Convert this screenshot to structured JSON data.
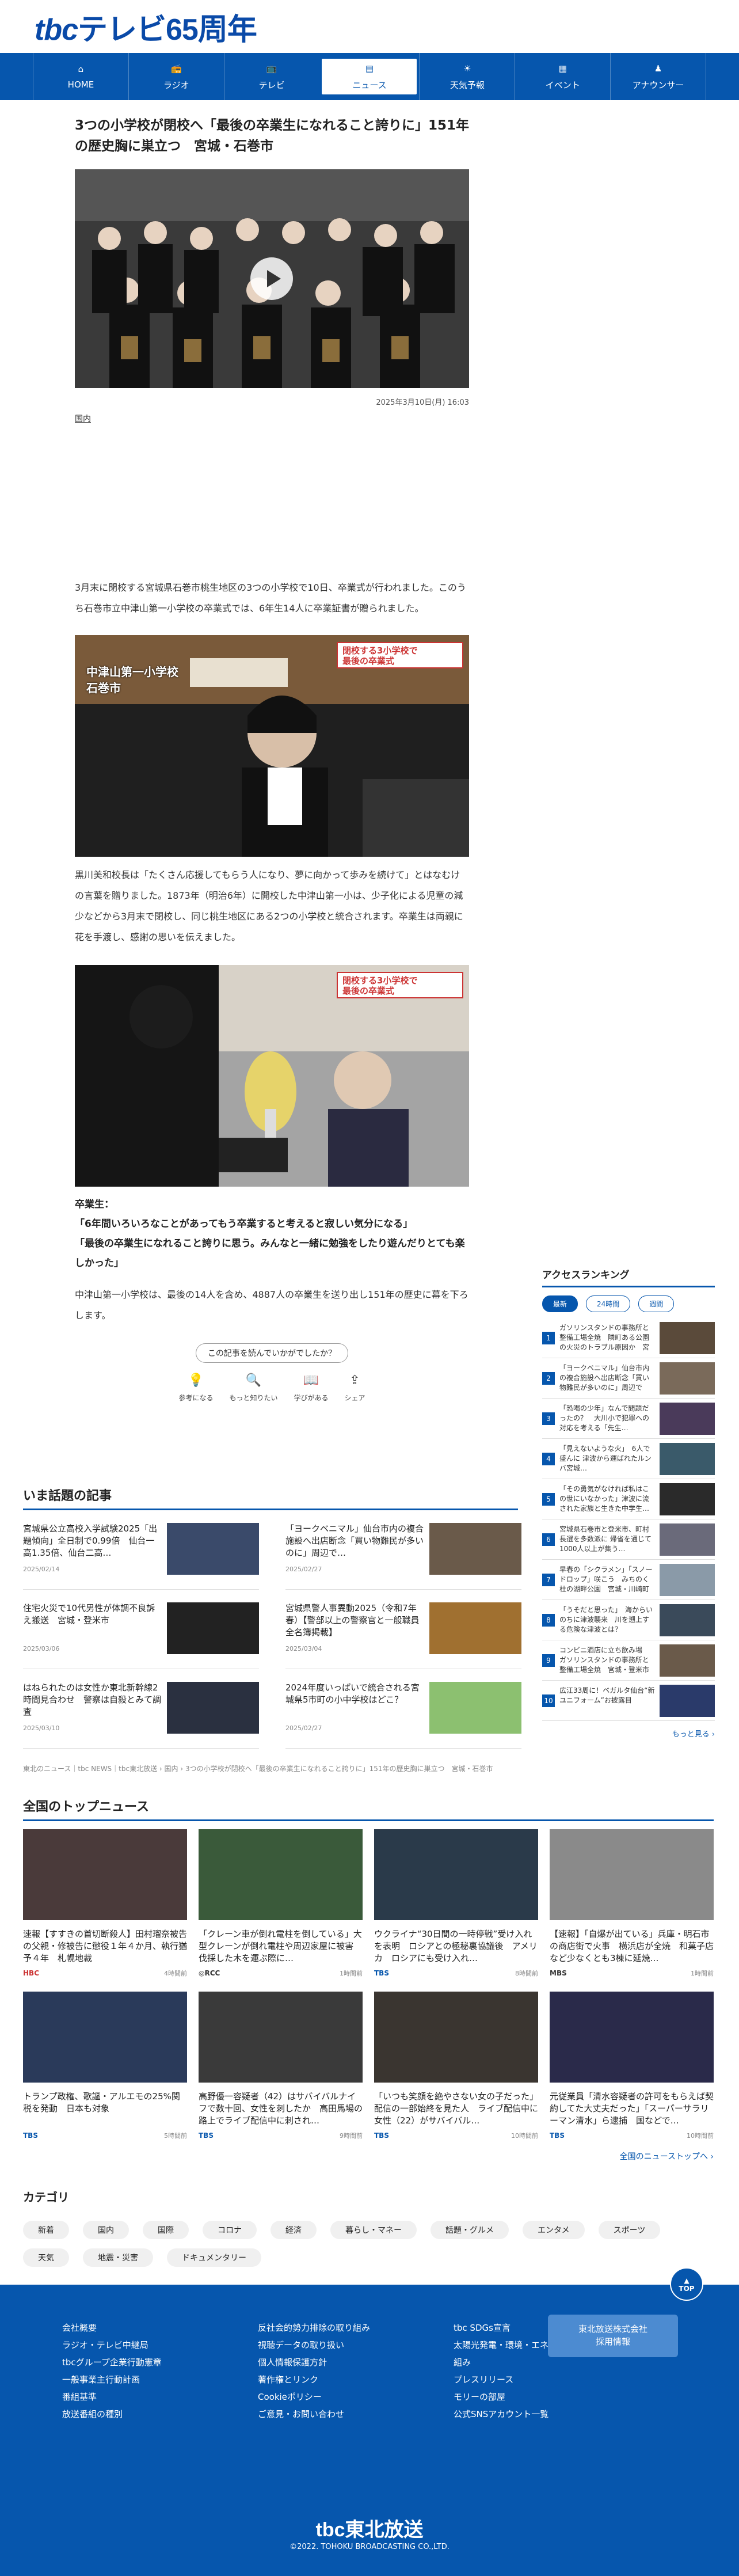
{
  "logo": {
    "tbc": "tbc",
    "text": "テレビ65周年"
  },
  "nav": [
    {
      "label": "HOME",
      "icon": "home-icon",
      "glyph": "⌂"
    },
    {
      "label": "ラジオ",
      "icon": "radio-icon",
      "glyph": "📻"
    },
    {
      "label": "テレビ",
      "icon": "tv-icon",
      "glyph": "📺"
    },
    {
      "label": "ニュース",
      "icon": "news-icon",
      "glyph": "▤"
    },
    {
      "label": "天気予報",
      "icon": "weather-icon",
      "glyph": "☀"
    },
    {
      "label": "イベント",
      "icon": "event-icon",
      "glyph": "▦"
    },
    {
      "label": "アナウンサー",
      "icon": "announcer-icon",
      "glyph": "♟"
    }
  ],
  "article": {
    "title": "3つの小学校が閉校へ「最後の卒業生になれること誇りに」151年の歴史胸に巣立つ　宮城・石巻市",
    "date": "2025年3月10日(月) 16:03",
    "tag": "国内",
    "p1": "3月末に閉校する宮城県石巻市桃生地区の3つの小学校で10日、卒業式が行われました。このうち石巻市立中津山第一小学校の卒業式では、6年生14人に卒業証書が贈られました。",
    "photo1_location": "中津山第一小学校\n石巻市",
    "photo_caption_top": "閉校する3小学校で",
    "photo_caption_bottom": "最後の卒業式",
    "p2": "黒川美和校長は「たくさん応援してもらう人になり、夢に向かって歩みを続けて」とはなむけの言葉を贈りました。1873年（明治6年）に開校した中津山第一小は、少子化による児童の減少などから3月末で閉校し、同じ桃生地区にある2つの小学校と統合されます。卒業生は両親に花を手渡し、感謝の思いを伝えました。",
    "quote_label": "卒業生：",
    "quote1": "「6年間いろいろなことがあってもう卒業すると考えると寂しい気分になる」",
    "quote2": "「最後の卒業生になれること誇りに思う。みんなと一緒に勉強をしたり遊んだりとても楽しかった」",
    "p3": "中津山第一小学校は、最後の14人を含め、4887人の卒業生を送り出し151年の歴史に幕を下ろします。",
    "feedback_prompt": "この記事を読んでいかがでしたか？",
    "feedback": [
      {
        "label": "参考になる",
        "icon": "lightbulb-icon",
        "glyph": "💡"
      },
      {
        "label": "もっと知りたい",
        "icon": "magnifier-icon",
        "glyph": "🔍"
      },
      {
        "label": "学びがある",
        "icon": "book-icon",
        "glyph": "📖"
      },
      {
        "label": "シェア",
        "icon": "share-icon",
        "glyph": "⇪"
      }
    ]
  },
  "ranking": {
    "title": "アクセスランキング",
    "tabs": [
      "最新",
      "24時間",
      "週間"
    ],
    "items": [
      "ガソリンスタンドの事務所と整備工場全焼　隣町ある公園の火災のトラブル原因か　宮城・登米市",
      "「ヨークベニマル」仙台市内の複合施設へ出店断念「買い物難民が多いのに」周辺では…",
      "「恐喝の少年」なんで問題だったの？　大川小で犯罪への対応を考える「先生…",
      "「見えないような火」　6人で盛んに 津波から運ばれたルンバ宮城…",
      "「その勇気がなければ私はこの世にいなかった」津波に流された家族と生きた中学生…",
      "宮城県石巻市と登米市、町村長選を多数派に 帰省を通じて1000人以上が集う…",
      "早春の「シクラメン」「スノードロップ」咲こう　みちのく杜の湖畔公園　宮城・川崎町",
      "「うそだと思った」　海からいのちに津波襲来　川を遡上する危険な津波とは？",
      "コンビニ酒店に立ち飲み場　ガソリンスタンドの事務所と整備工場全焼　宮城・登米市",
      "広江33周に！ベガルタ仙台“新ユニフォーム”お披露目"
    ],
    "more": "もっと見る ›"
  },
  "trending": {
    "title": "いま話題の記事",
    "items": [
      {
        "text": "宮城県公立高校入学試験2025「出題傾向」全日制で0.99倍　仙台一高1.35倍、仙台二高…",
        "date": "2025/02/14"
      },
      {
        "text": "「ヨークベニマル」仙台市内の複合施設へ出店断念「買い物難民が多いのに」周辺で…",
        "date": "2025/02/27"
      },
      {
        "text": "住宅火災で10代男性が体調不良訴え搬送　宮城・登米市",
        "date": "2025/03/06"
      },
      {
        "text": "宮城県警人事異動2025（令和7年春）【警部以上の警察官と一般職員全名簿掲載】",
        "date": "2025/03/04"
      },
      {
        "text": "はねられたのは女性か東北新幹線2時間見合わせ　警察は自殺とみて調査",
        "date": "2025/03/10"
      },
      {
        "text": "2024年度いっぱいで統合される宮城県5市町の小中学校はどこ？",
        "date": "2025/02/27"
      }
    ],
    "breadcrumb": "東北のニュース｜tbc NEWS｜tbc東北放送 › 国内 › 3つの小学校が閉校へ「最後の卒業生になれること誇りに」151年の歴史胸に巣立つ　宮城・石巻市"
  },
  "topnews": {
    "title": "全国のトップニュース",
    "items": [
      {
        "text": "速報【すすきの首切断殺人】田村瑠奈被告の父親・修被告に懲役１年４か月、執行猶予４年　札幌地裁",
        "src": "HBC",
        "ago": "4時間前"
      },
      {
        "text": "「クレーン車が倒れ電柱を倒している」大型クレーンが倒れ電柱や周辺家屋に被害　伐採した木を運ぶ際に…",
        "src": "◎RCC",
        "ago": "1時間前"
      },
      {
        "text": "ウクライナ“30日間の一時停戦”受け入れを表明　ロシアとの極秘裏協議後　アメリカ　ロシアにも受け入れ…",
        "src": "TBS",
        "ago": "8時間前"
      },
      {
        "text": "【速報】「自爆が出ている」兵庫・明石市の商店街で火事　横浜店が全焼　和菓子店など少なくとも3棟に延焼…",
        "src": "MBS",
        "ago": "1時間前"
      },
      {
        "text": "トランプ政権、歌謳・アルエモの25%関税を発動　日本も対象",
        "src": "TBS",
        "ago": "5時間前"
      },
      {
        "text": "高野優一容疑者（42）はサバイバルナイフで数十回、女性を刺したか　高田馬場の路上でライブ配信中に刺され…",
        "src": "TBS",
        "ago": "9時間前"
      },
      {
        "text": "「いつも笑顔を絶やさない女の子だった」配信の一部始終を見た人　ライブ配信中に女性（22）がサバイバル…",
        "src": "TBS",
        "ago": "10時間前"
      },
      {
        "text": "元従業員「清水容疑者の許可をもらえば契約してた大丈夫だった」「スーパーサラリーマン清水」ら逮捕　国などで…",
        "src": "TBS",
        "ago": "10時間前"
      }
    ],
    "all": "全国のニューストップへ ›"
  },
  "categories": {
    "title": "カテゴリ",
    "items": [
      "新着",
      "国内",
      "国際",
      "コロナ",
      "経済",
      "暮らし・マネー",
      "話題・グルメ",
      "エンタメ",
      "スポーツ",
      "天気",
      "地震・災害",
      "ドキュメンタリー"
    ]
  },
  "footer": {
    "top": "TOP",
    "col1": [
      "会社概要",
      "ラジオ・テレビ中継局",
      "tbcグループ企業行動憲章",
      "一般事業主行動計画",
      "番組基準",
      "放送番組の種別"
    ],
    "col2": [
      "反社会的勢力排除の取り組み",
      "視聴データの取り扱い",
      "個人情報保護方針",
      "著作権とリンク",
      "Cookieポリシー",
      "ご意見・お問い合わせ"
    ],
    "col3": [
      "tbc SDGs宣言",
      "太陽光発電・環境・エネルギー分野への取り組み",
      "プレスリリース",
      "モリーの部屋",
      "公式SNSアカウント一覧"
    ],
    "recruit": "東北放送株式会社\n採用情報",
    "logo": "tbc東北放送",
    "copyright": "©2022. TOHOKU BROADCASTING CO.,LTD."
  },
  "colors": {
    "brand": "#0656ad",
    "accent": "#c33"
  }
}
